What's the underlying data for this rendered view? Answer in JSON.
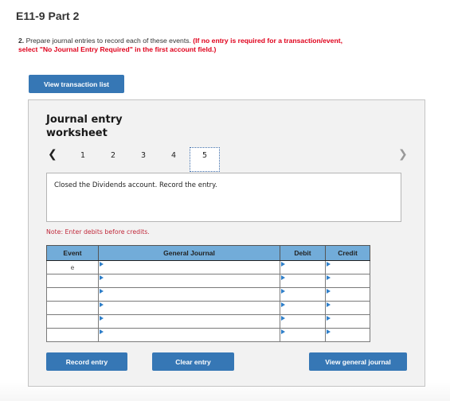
{
  "page": {
    "title": "E11-9 Part 2",
    "question_number": "2.",
    "question_text": "Prepare journal entries to record each of these events.",
    "question_instruction": "(If no entry is required for a transaction/event, select \"No Journal Entry Required\" in the first account field.)"
  },
  "buttons": {
    "view_transaction_list": "View transaction list",
    "record_entry": "Record entry",
    "clear_entry": "Clear entry",
    "view_general_journal": "View general journal"
  },
  "worksheet": {
    "title_line1": "Journal entry",
    "title_line2": "worksheet",
    "prev_icon": "chevron-left-icon",
    "next_icon": "chevron-right-icon",
    "tabs": [
      "1",
      "2",
      "3",
      "4",
      "5"
    ],
    "active_tab": "5",
    "description": "Closed the Dividends account. Record the entry.",
    "note": "Note: Enter debits before credits."
  },
  "journal": {
    "headers": [
      "Event",
      "General Journal",
      "Debit",
      "Credit"
    ],
    "rows": [
      {
        "event": "e",
        "account": "",
        "debit": "",
        "credit": ""
      },
      {
        "event": "",
        "account": "",
        "debit": "",
        "credit": ""
      },
      {
        "event": "",
        "account": "",
        "debit": "",
        "credit": ""
      },
      {
        "event": "",
        "account": "",
        "debit": "",
        "credit": ""
      },
      {
        "event": "",
        "account": "",
        "debit": "",
        "credit": ""
      },
      {
        "event": "",
        "account": "",
        "debit": "",
        "credit": ""
      }
    ]
  },
  "colors": {
    "primary_button": "#3677b5",
    "table_header": "#72acd9",
    "instruction_red": "#e0001b",
    "note_red": "#c0283a"
  }
}
